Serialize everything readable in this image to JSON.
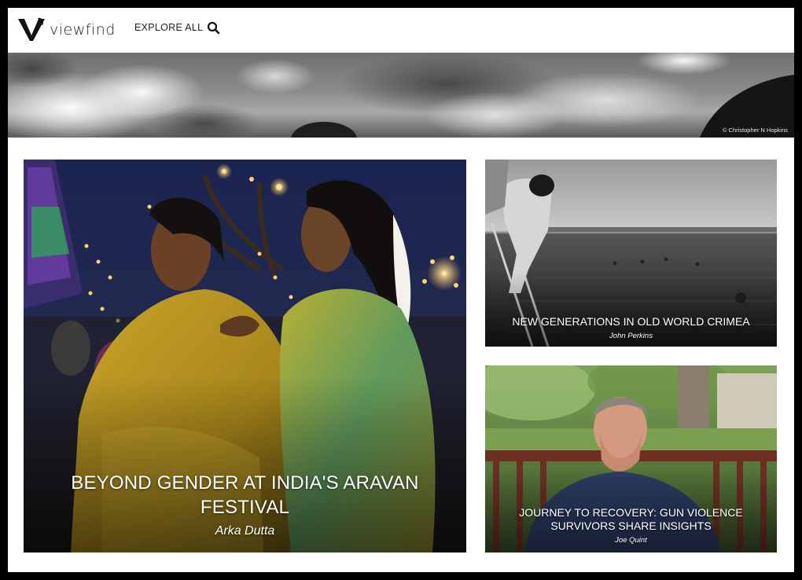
{
  "header": {
    "logo_text": "viewfind",
    "explore_label": "EXPLORE ALL",
    "search_icon": "search-icon"
  },
  "banner": {
    "credit": "© Christopher N Hopkins"
  },
  "stories": {
    "main": {
      "title": "BEYOND GENDER AT INDIA'S ARAVAN FESTIVAL",
      "author": "Arka Dutta"
    },
    "top_right": {
      "title": "NEW GENERATIONS IN OLD WORLD CRIMEA",
      "author": "John Perkins"
    },
    "bottom_right": {
      "title": "JOURNEY TO RECOVERY: GUN VIOLENCE SURVIVORS SHARE INSIGHTS",
      "author": "Joe Quint"
    }
  },
  "colors": {
    "page_background": "#000000",
    "content_background": "#ffffff",
    "text_dark": "#222222",
    "caption_text": "#ffffff"
  }
}
